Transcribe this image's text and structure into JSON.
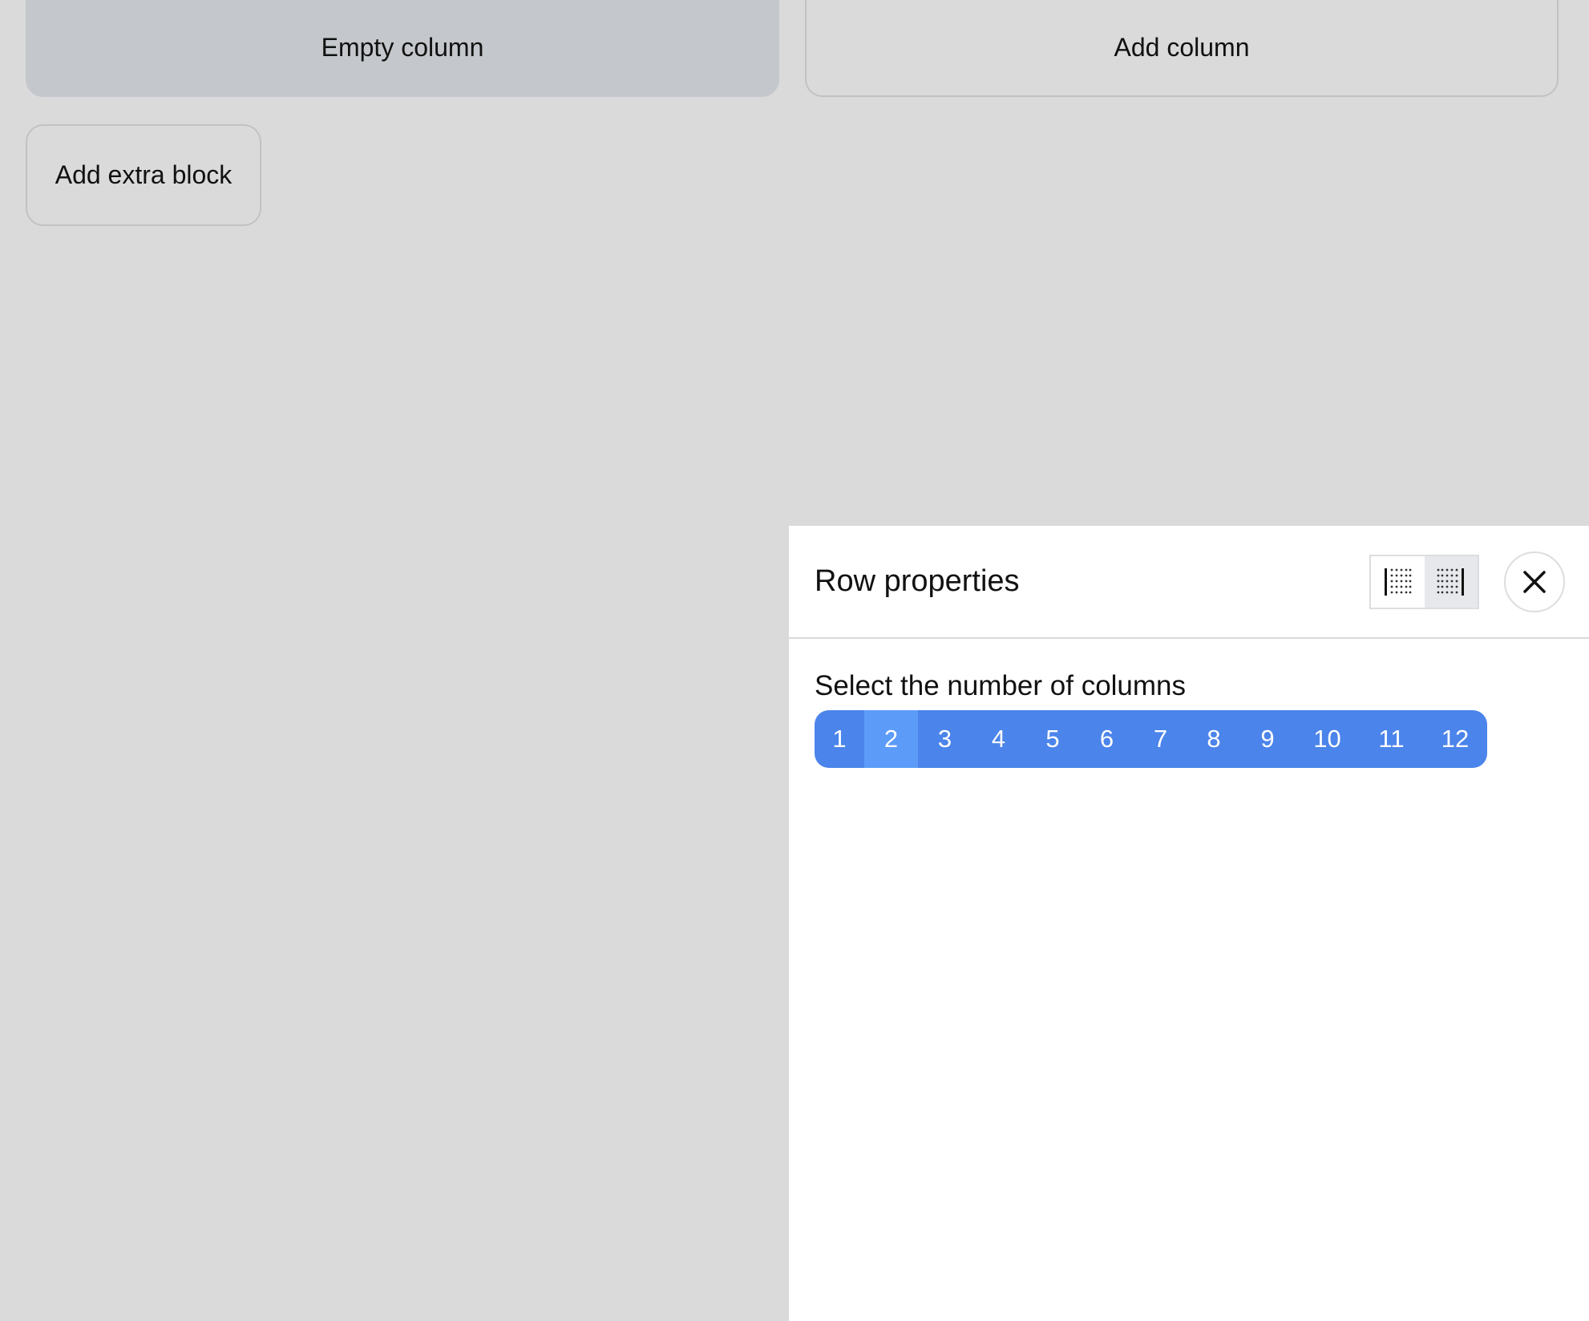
{
  "canvas": {
    "empty_column_label": "Empty column",
    "add_column_label": "Add column",
    "add_extra_block_label": "Add extra block"
  },
  "panel": {
    "title": "Row properties",
    "toggle_left_icon": "align-grid-left-icon",
    "toggle_right_icon": "align-grid-right-icon",
    "active_toggle": "right",
    "close_icon": "close-icon",
    "columns_label": "Select the number of columns",
    "column_options": [
      "1",
      "2",
      "3",
      "4",
      "5",
      "6",
      "7",
      "8",
      "9",
      "10",
      "11",
      "12"
    ],
    "selected_columns": "2"
  },
  "colors": {
    "canvas_bg": "#dadadb",
    "empty_column_bg": "#c4c7cb",
    "selector_bg": "#4b84ea",
    "selector_selected": "#5c9bf8",
    "panel_bg": "#ffffff"
  }
}
